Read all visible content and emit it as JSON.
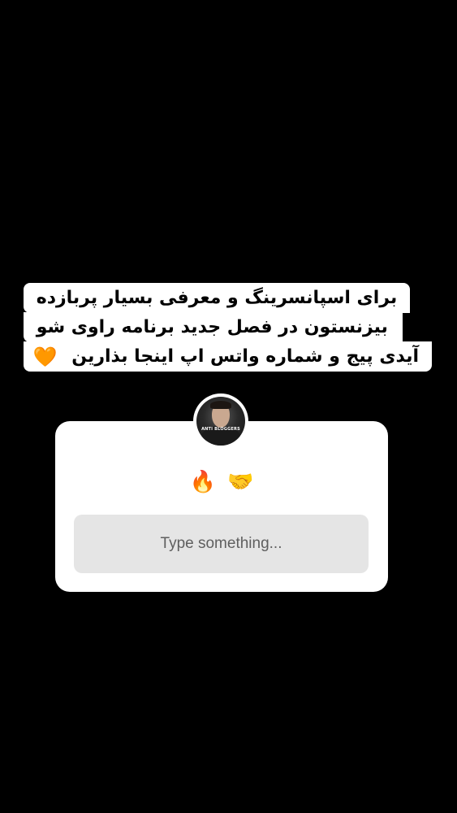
{
  "caption": {
    "lines": [
      "برای اسپانسرینگ و معرفی بسیار پربازده",
      "بیزنستون در فصل جدید برنامه راوی شو",
      "آیدی پیج و شماره واتس اپ اینجا بذارین"
    ],
    "trailing_emoji": "🧡"
  },
  "sticker": {
    "avatar_label": "ANTI BLOGGERS",
    "emojis": {
      "fire": "🔥",
      "handshake": "🤝"
    },
    "answer_placeholder": "Type something..."
  }
}
